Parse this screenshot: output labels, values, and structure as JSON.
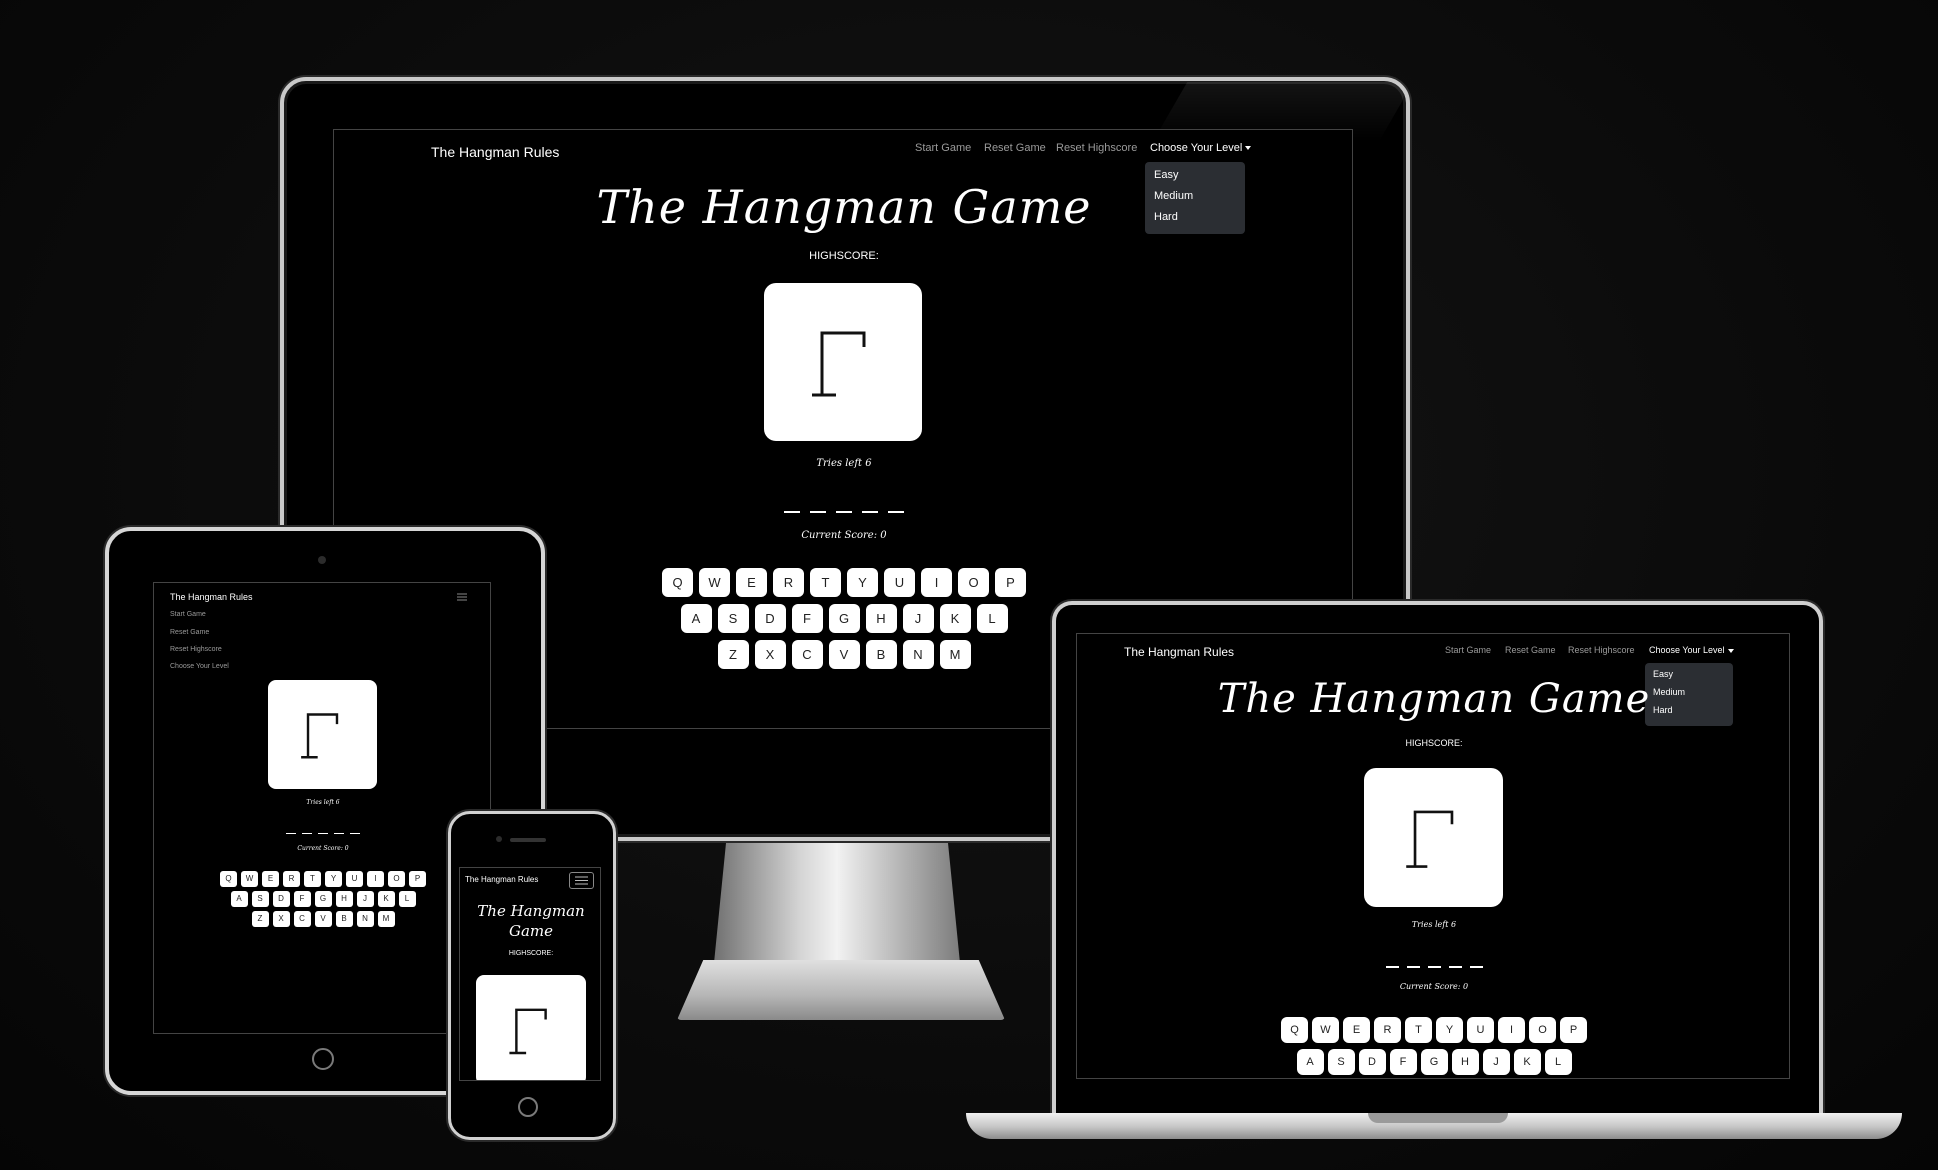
{
  "site": {
    "brand": "The Hangman Rules",
    "nav": {
      "start": "Start Game",
      "reset": "Reset Game",
      "reset_highscore": "Reset Highscore",
      "level": "Choose Your Level"
    },
    "levels": [
      "Easy",
      "Medium",
      "Hard"
    ]
  },
  "game": {
    "title": "The Hangman Game",
    "title_phone_line1": "The Hangman",
    "title_phone_line2": "Game",
    "highscore_label": "HIGHSCORE:",
    "tries_left": "Tries left 6",
    "current_score": "Current Score: 0"
  },
  "keyboard": {
    "row1": [
      "Q",
      "W",
      "E",
      "R",
      "T",
      "Y",
      "U",
      "I",
      "O",
      "P"
    ],
    "row2": [
      "A",
      "S",
      "D",
      "F",
      "G",
      "H",
      "J",
      "K",
      "L"
    ],
    "row3": [
      "Z",
      "X",
      "C",
      "V",
      "B",
      "N",
      "M"
    ]
  },
  "icons": {
    "menu": "hamburger-icon",
    "gallows": "gallows-icon",
    "caret": "caret-down-icon"
  }
}
